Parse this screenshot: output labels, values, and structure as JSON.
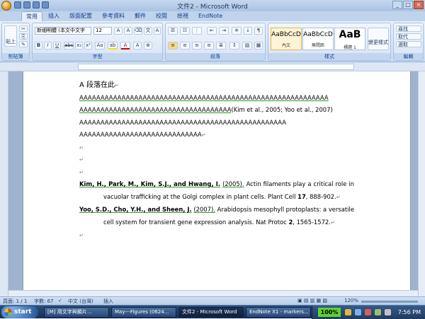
{
  "window": {
    "title": "文件2 - Microsoft Word"
  },
  "tabs": [
    "常用",
    "插入",
    "版面配置",
    "參考資料",
    "郵件",
    "校閱",
    "檢視",
    "EndNote"
  ],
  "ribbon": {
    "clipboard": {
      "label": "剪貼簿",
      "paste": "貼上"
    },
    "font": {
      "label": "字型",
      "font_name": "新細明體 (本文中文字",
      "font_size": "12"
    },
    "paragraph": {
      "label": "段落"
    },
    "styles": {
      "label": "樣式",
      "items": [
        {
          "sample": "AaBbCcD",
          "name": "內文"
        },
        {
          "sample": "AaBbCcD",
          "name": "無間距"
        },
        {
          "sample": "AaB",
          "name": "標題 1"
        }
      ],
      "change": "變更樣式"
    },
    "editing": {
      "label": "編輯",
      "find": "尋找",
      "replace": "取代",
      "select": "選取"
    }
  },
  "document": {
    "line1": "A 段落在此",
    "para_a1": "AAAAAAAAAAAAAAAAAAAAAAAAAAAAAAAAAAAAAAAAAAAAAAAAAAAAAAAAAAA",
    "para_a2": "AAAAAAAAAAAAAAAAAAAAAAAAAAAAAAAAAAAA",
    "citation": "(Kim et al., 2005; Yoo et al., 2007)",
    "para_a3": "AAAAAAAAAAAAAAAAAAAAAAAAAAAAAAAAAAAAAAAAAAAAAAAAA",
    "para_a4": "AAAAAAAAAAAAAAAAAAAAAAAAAAAAA",
    "ref1": {
      "authors": "Kim, H., Park, M., Kim, S.J., and Hwang, I.",
      "year": "(2005).",
      "text": "Actin filaments play a critical role in vacuolar trafficking at the Golgi complex in plant cells. Plant Cell",
      "volume": "17",
      "pages": ", 888-902."
    },
    "ref2": {
      "authors": "Yoo, S.D., Cho, Y.H., and Sheen, J.",
      "year": "(2007).",
      "text": "Arabidopsis mesophyll protoplasts: a versatile cell system for transient gene expression analysis. Nat Protoc",
      "volume": "2",
      "pages": ", 1565-1572."
    }
  },
  "status": {
    "page": "頁面: 1 / 1",
    "words": "字數: 67",
    "lang": "中文 (台灣)",
    "mode": "插入",
    "zoom": "120%"
  },
  "taskbar": {
    "start": "start",
    "items": [
      "[M] 用文字與顯片...",
      "May---Figures (0624...",
      "文件2 - Microsoft Word",
      "EndNote X1 - markers..."
    ],
    "tray_zoom": "100%",
    "clock": "7:56 PM"
  }
}
